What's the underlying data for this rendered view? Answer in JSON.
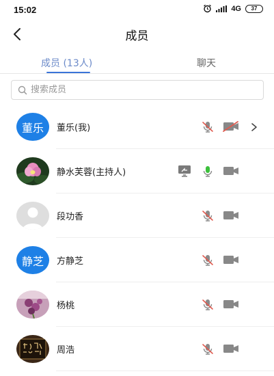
{
  "status_bar": {
    "time": "15:02",
    "network": "4G",
    "battery": "37"
  },
  "header": {
    "title": "成员"
  },
  "tabs": [
    {
      "label": "成员 (13人)",
      "active": true
    },
    {
      "label": "聊天",
      "active": false
    }
  ],
  "search": {
    "placeholder": "搜索成员",
    "value": ""
  },
  "members": [
    {
      "avatar_text": "董乐",
      "avatar_type": "text",
      "name": "董乐(我)",
      "mic": "muted",
      "camera": "off",
      "chevron": true,
      "sharing": false
    },
    {
      "avatar_text": "",
      "avatar_type": "photo-lotus",
      "name": "静水芙蓉(主持人)",
      "mic": "on",
      "camera": "on",
      "chevron": false,
      "sharing": true
    },
    {
      "avatar_text": "",
      "avatar_type": "default",
      "name": "段功香",
      "mic": "muted",
      "camera": "on",
      "chevron": false,
      "sharing": false
    },
    {
      "avatar_text": "静芝",
      "avatar_type": "text",
      "name": "方静芝",
      "mic": "muted",
      "camera": "on",
      "chevron": false,
      "sharing": false
    },
    {
      "avatar_text": "",
      "avatar_type": "photo-flowers",
      "name": "杨桃",
      "mic": "muted",
      "camera": "on",
      "chevron": false,
      "sharing": false
    },
    {
      "avatar_text": "",
      "avatar_type": "photo-calligraphy",
      "name": "周浩",
      "mic": "muted",
      "camera": "on",
      "chevron": false,
      "sharing": false
    }
  ],
  "colors": {
    "accent": "#3a74d8",
    "avatar_blue": "#1e80e6",
    "muted_red": "#e05a4f",
    "mic_on_green": "#3cc03c",
    "icon_gray": "#8a8a8a"
  }
}
